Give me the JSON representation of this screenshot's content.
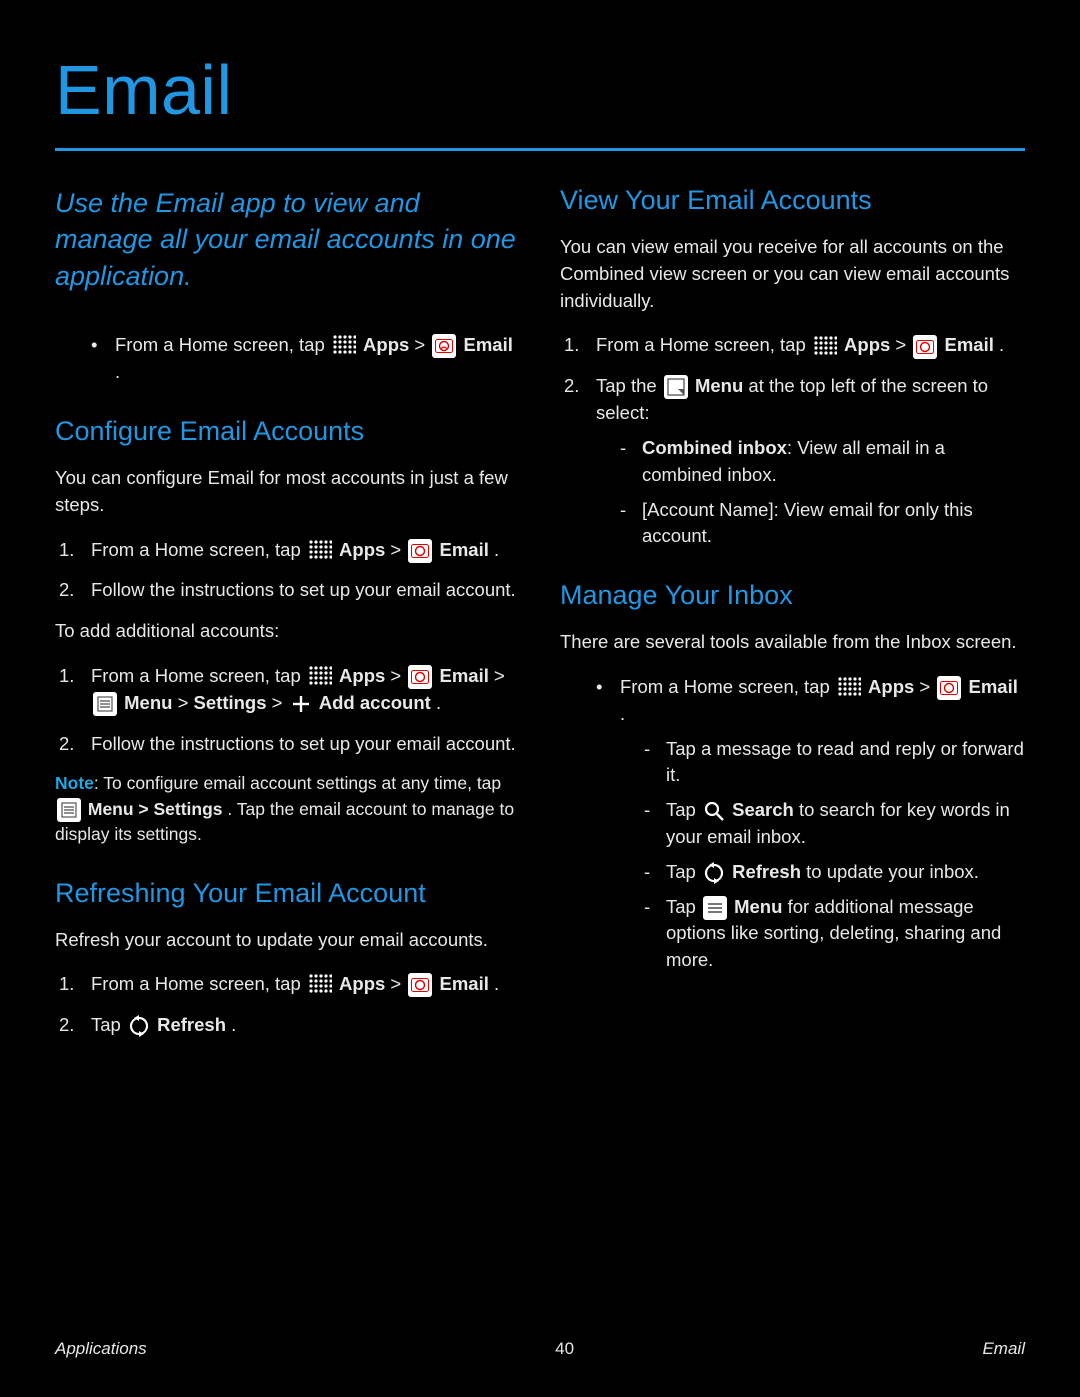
{
  "title": "Email",
  "intro": "Use the Email app to view and manage all your email accounts in one application.",
  "leadin": {
    "pre": "From a Home screen, tap ",
    "apps": " Apps",
    "mid": " > ",
    "email": " Email",
    "post": "."
  },
  "configure": {
    "heading": "Configure Email Accounts",
    "p1": "You can configure Email for most accounts in just a few steps.",
    "steps1": {
      "s1_pre": "From a Home screen, tap ",
      "s1_apps": " Apps",
      "s1_mid": " > ",
      "s1_email": " Email",
      "s1_post": ".",
      "s2": "Follow the instructions to set up your email account."
    },
    "p2": "To add additional accounts:",
    "steps2": {
      "s1_pre": "From a Home screen, tap ",
      "s1_apps": " Apps",
      "s1_mid": " > ",
      "s1_email": " Email",
      "s1_mid2": " > ",
      "s1_menu": " Menu",
      "s1_mid3": " > ",
      "s1_settings": "Settings",
      "s1_mid4": " > ",
      "s1_add": " Add account",
      "s1_post": ".",
      "s2": "Follow the instructions to set up your email account."
    },
    "note_label": "Note",
    "note_pre": ": To configure email account settings at any time, tap ",
    "note_menu": " Menu > Settings",
    "note_post": " . Tap the email account to manage to display its settings."
  },
  "refreshing": {
    "heading": "Refreshing Your Email Account",
    "p1": "Refresh your account to update your email accounts.",
    "steps": {
      "s1_pre": "From a Home screen, tap ",
      "s1_apps": " Apps",
      "s1_mid": " > ",
      "s1_email": " Email",
      "s1_post": ".",
      "s2_pre": "Tap ",
      "s2_refresh": " Refresh",
      "s2_post": "."
    }
  },
  "view": {
    "heading": "View Your Email Accounts",
    "p1": "You can view email you receive for all accounts on the Combined view screen or you can view email accounts individually.",
    "steps": {
      "s1_pre": "From a Home screen, tap ",
      "s1_apps": " Apps",
      "s1_mid": " > ",
      "s1_email": " Email",
      "s1_post": ".",
      "s2_pre": "Tap the ",
      "s2_menu": " Menu",
      "s2_post": " at the top left of the screen to select:",
      "s2_b1_label": "Combined inbox",
      "s2_b1_post": ": View all email in a combined inbox.",
      "s2_b2": "[Account Name]: View email for only this account."
    }
  },
  "manage": {
    "heading": "Manage Your Inbox",
    "p1": "There are several tools available from the Inbox screen.",
    "lead_pre": "From a Home screen, tap ",
    "lead_apps": " Apps",
    "lead_mid": " > ",
    "lead_email": " Email",
    "lead_post": ".",
    "b1_pre": "Tap a message to read and reply or forward it.",
    "b2_pre": "Tap ",
    "b2_search": " Search",
    "b2_post": " to search for key words in your email inbox.",
    "b3_pre": "Tap ",
    "b3_refresh": " Refresh",
    "b3_post": " to update your inbox.",
    "b4_pre": "Tap ",
    "b4_menu": " Menu",
    "b4_post": " for additional message options like sorting, deleting, sharing and more."
  },
  "footer": {
    "left": "Applications",
    "center": "40",
    "right": "Email"
  }
}
